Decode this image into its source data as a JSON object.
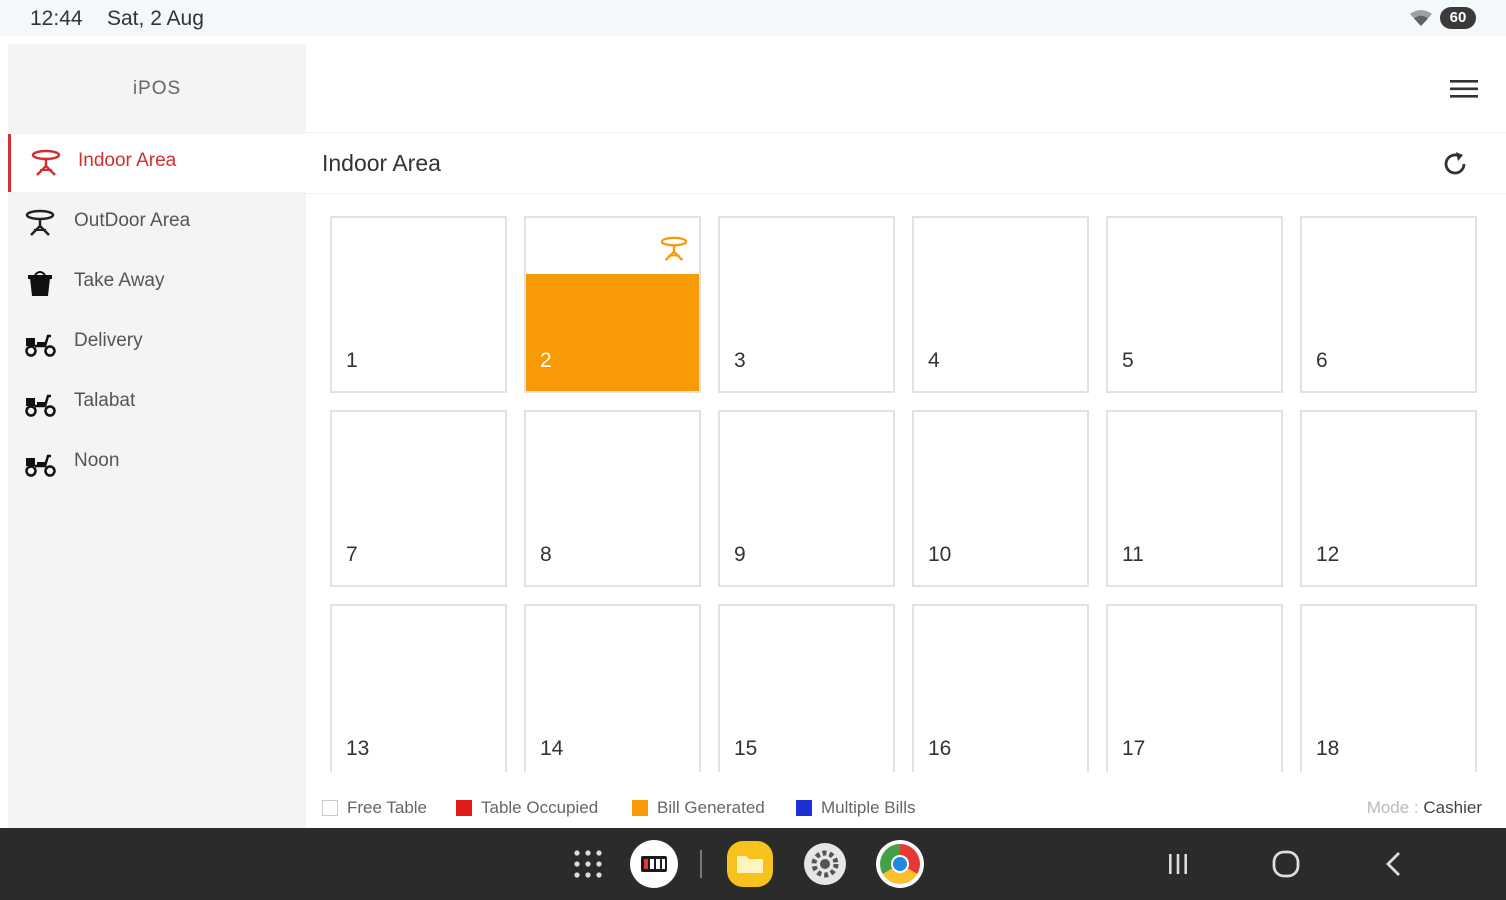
{
  "status_bar": {
    "time": "12:44",
    "date": "Sat, 2 Aug",
    "battery": "60"
  },
  "sidebar": {
    "brand": "iPOS",
    "items": [
      {
        "label": "Indoor Area",
        "icon": "table-icon",
        "active": true
      },
      {
        "label": "OutDoor Area",
        "icon": "table-icon",
        "active": false
      },
      {
        "label": "Take Away",
        "icon": "takeaway-bag-icon",
        "active": false
      },
      {
        "label": "Delivery",
        "icon": "scooter-icon",
        "active": false
      },
      {
        "label": "Talabat",
        "icon": "scooter-icon",
        "active": false
      },
      {
        "label": "Noon",
        "icon": "scooter-icon",
        "active": false
      }
    ]
  },
  "header": {
    "menu_icon": "hamburger-menu-icon"
  },
  "area": {
    "title": "Indoor Area",
    "refresh_icon": "refresh-icon"
  },
  "tables": [
    {
      "number": "1",
      "status": "free"
    },
    {
      "number": "2",
      "status": "bill_generated"
    },
    {
      "number": "3",
      "status": "free"
    },
    {
      "number": "4",
      "status": "free"
    },
    {
      "number": "5",
      "status": "free"
    },
    {
      "number": "6",
      "status": "free"
    },
    {
      "number": "7",
      "status": "free"
    },
    {
      "number": "8",
      "status": "free"
    },
    {
      "number": "9",
      "status": "free"
    },
    {
      "number": "10",
      "status": "free"
    },
    {
      "number": "11",
      "status": "free"
    },
    {
      "number": "12",
      "status": "free"
    },
    {
      "number": "13",
      "status": "free"
    },
    {
      "number": "14",
      "status": "free"
    },
    {
      "number": "15",
      "status": "free"
    },
    {
      "number": "16",
      "status": "free"
    },
    {
      "number": "17",
      "status": "free"
    },
    {
      "number": "18",
      "status": "free"
    }
  ],
  "legend": [
    {
      "label": "Free Table",
      "color": "#ffffff"
    },
    {
      "label": "Table Occupied",
      "color": "#e01b1b"
    },
    {
      "label": "Bill Generated",
      "color": "#f79a06"
    },
    {
      "label": "Multiple Bills",
      "color": "#1e2fd6"
    }
  ],
  "mode": {
    "label": "Mode :",
    "value": "Cashier"
  },
  "colors": {
    "accent": "#d32f2f",
    "bill_generated": "#f79a06",
    "statusbar_bg": "#f3f8fa",
    "navbar_bg": "#2b2b2b"
  },
  "dock": [
    {
      "icon": "app-drawer-icon"
    },
    {
      "icon": "ipos-app-icon"
    },
    {
      "icon": "files-app-icon"
    },
    {
      "icon": "settings-app-icon"
    },
    {
      "icon": "chrome-app-icon"
    }
  ],
  "system_nav": [
    {
      "icon": "recents-icon"
    },
    {
      "icon": "home-icon"
    },
    {
      "icon": "back-icon"
    }
  ]
}
